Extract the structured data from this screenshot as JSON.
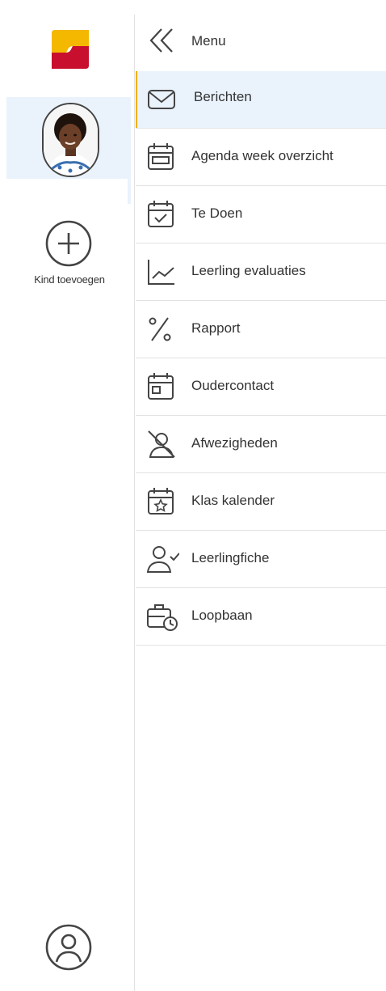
{
  "colors": {
    "brand_yellow": "#f5b800",
    "brand_red": "#c8102e",
    "selected_bg": "#eaf3fc",
    "active_accent": "#f0b000",
    "divider": "#e2e2e2",
    "icon_stroke": "#444444"
  },
  "rail": {
    "logo_icon": "school-app-logo",
    "children": [
      {
        "avatar_icon": "child-avatar-photo",
        "selected": true
      }
    ],
    "add_child_icon": "plus-circle-icon",
    "add_child_label": "Kind toevoegen",
    "account_icon": "user-circle-icon"
  },
  "menu": {
    "collapse_icon": "double-chevron-left-icon",
    "title": "Menu",
    "items": [
      {
        "label": "Berichten",
        "icon": "mail-icon",
        "active": true
      },
      {
        "label": "Agenda week overzicht",
        "icon": "calendar-icon",
        "active": false
      },
      {
        "label": "Te Doen",
        "icon": "calendar-check-icon",
        "active": false
      },
      {
        "label": "Leerling evaluaties",
        "icon": "chart-line-icon",
        "active": false
      },
      {
        "label": "Rapport",
        "icon": "percent-icon",
        "active": false
      },
      {
        "label": "Oudercontact",
        "icon": "calendar-small-icon",
        "active": false
      },
      {
        "label": "Afwezigheden",
        "icon": "user-off-icon",
        "active": false
      },
      {
        "label": "Klas kalender",
        "icon": "calendar-star-icon",
        "active": false
      },
      {
        "label": "Leerlingfiche",
        "icon": "user-check-icon",
        "active": false
      },
      {
        "label": "Loopbaan",
        "icon": "briefcase-clock-icon",
        "active": false
      }
    ]
  }
}
